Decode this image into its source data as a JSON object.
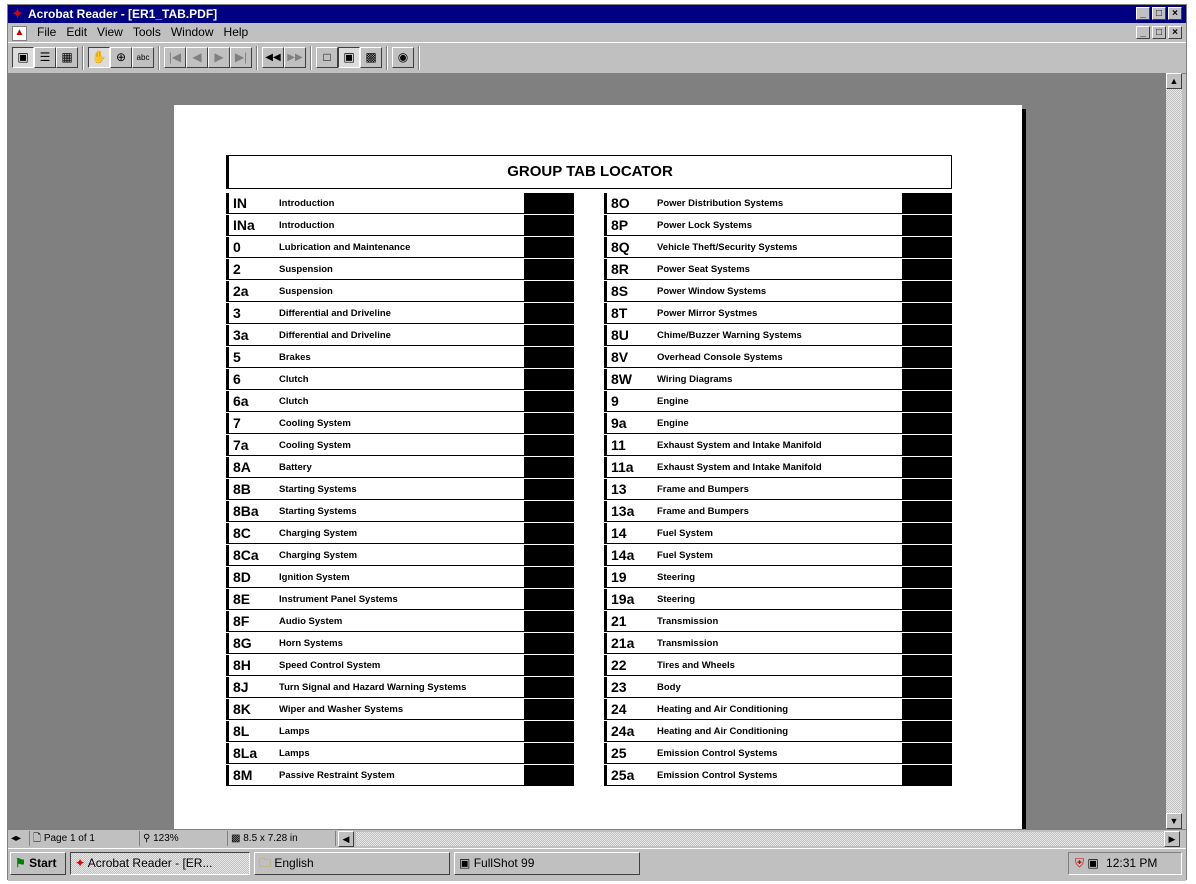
{
  "window": {
    "title": "Acrobat Reader - [ER1_TAB.PDF]",
    "app_icon": "acrobat-icon",
    "controls": [
      "_",
      "□",
      "×"
    ]
  },
  "menu": {
    "items": [
      {
        "label": "File"
      },
      {
        "label": "Edit"
      },
      {
        "label": "View"
      },
      {
        "label": "Tools"
      },
      {
        "label": "Window"
      },
      {
        "label": "Help"
      }
    ]
  },
  "toolbar": {
    "buttons": [
      "page-only-icon",
      "bookmarks-and-page-icon",
      "thumbnails-and-page-icon",
      "hand-tool-icon",
      "zoom-tool-icon",
      "text-select-icon",
      "first-page-icon",
      "previous-page-icon",
      "next-page-icon",
      "last-page-icon",
      "go-back-icon",
      "go-forward-icon",
      "actual-size-icon",
      "fit-page-icon",
      "fit-width-icon",
      "find-icon"
    ]
  },
  "document": {
    "heading": "GROUP TAB LOCATOR",
    "left_column": [
      {
        "code": "IN",
        "desc": "Introduction"
      },
      {
        "code": "INa",
        "desc": "Introduction"
      },
      {
        "code": "0",
        "desc": "Lubrication and Maintenance"
      },
      {
        "code": "2",
        "desc": "Suspension"
      },
      {
        "code": "2a",
        "desc": "Suspension"
      },
      {
        "code": "3",
        "desc": "Differential and Driveline"
      },
      {
        "code": "3a",
        "desc": "Differential and Driveline"
      },
      {
        "code": "5",
        "desc": "Brakes"
      },
      {
        "code": "6",
        "desc": "Clutch"
      },
      {
        "code": "6a",
        "desc": "Clutch"
      },
      {
        "code": "7",
        "desc": "Cooling System"
      },
      {
        "code": "7a",
        "desc": "Cooling System"
      },
      {
        "code": "8A",
        "desc": "Battery"
      },
      {
        "code": "8B",
        "desc": "Starting Systems"
      },
      {
        "code": "8Ba",
        "desc": "Starting Systems"
      },
      {
        "code": "8C",
        "desc": "Charging System"
      },
      {
        "code": "8Ca",
        "desc": "Charging System"
      },
      {
        "code": "8D",
        "desc": "Ignition System"
      },
      {
        "code": "8E",
        "desc": "Instrument Panel Systems"
      },
      {
        "code": "8F",
        "desc": "Audio System"
      },
      {
        "code": "8G",
        "desc": "Horn Systems"
      },
      {
        "code": "8H",
        "desc": "Speed Control System"
      },
      {
        "code": "8J",
        "desc": "Turn Signal and Hazard Warning Systems"
      },
      {
        "code": "8K",
        "desc": "Wiper and Washer Systems"
      },
      {
        "code": "8L",
        "desc": "Lamps"
      },
      {
        "code": "8La",
        "desc": "Lamps"
      },
      {
        "code": "8M",
        "desc": "Passive Restraint System"
      }
    ],
    "right_column": [
      {
        "code": "8O",
        "desc": "Power Distribution Systems"
      },
      {
        "code": "8P",
        "desc": "Power Lock Systems"
      },
      {
        "code": "8Q",
        "desc": "Vehicle Theft/Security Systems"
      },
      {
        "code": "8R",
        "desc": "Power Seat Systems"
      },
      {
        "code": "8S",
        "desc": "Power Window Systems"
      },
      {
        "code": "8T",
        "desc": "Power Mirror Systmes"
      },
      {
        "code": "8U",
        "desc": "Chime/Buzzer Warning Systems"
      },
      {
        "code": "8V",
        "desc": "Overhead Console Systems"
      },
      {
        "code": "8W",
        "desc": "Wiring Diagrams"
      },
      {
        "code": "9",
        "desc": "Engine"
      },
      {
        "code": "9a",
        "desc": "Engine"
      },
      {
        "code": "11",
        "desc": "Exhaust System and Intake Manifold"
      },
      {
        "code": "11a",
        "desc": "Exhaust System and Intake Manifold"
      },
      {
        "code": "13",
        "desc": "Frame and Bumpers"
      },
      {
        "code": "13a",
        "desc": "Frame and Bumpers"
      },
      {
        "code": "14",
        "desc": "Fuel System"
      },
      {
        "code": "14a",
        "desc": "Fuel System"
      },
      {
        "code": "19",
        "desc": "Steering"
      },
      {
        "code": "19a",
        "desc": "Steering"
      },
      {
        "code": "21",
        "desc": "Transmission"
      },
      {
        "code": "21a",
        "desc": "Transmission"
      },
      {
        "code": "22",
        "desc": "Tires and Wheels"
      },
      {
        "code": "23",
        "desc": "Body"
      },
      {
        "code": "24",
        "desc": "Heating and Air Conditioning"
      },
      {
        "code": "24a",
        "desc": "Heating and Air Conditioning"
      },
      {
        "code": "25",
        "desc": "Emission Control Systems"
      },
      {
        "code": "25a",
        "desc": "Emission Control Systems"
      }
    ]
  },
  "statusbar": {
    "page": "Page 1 of 1",
    "zoom": "123%",
    "page_size": "8.5 x 7.28 in"
  },
  "taskbar": {
    "start": "Start",
    "tasks": [
      {
        "label": "Acrobat Reader - [ER...",
        "icon": "acrobat-icon",
        "active": true
      },
      {
        "label": "English",
        "icon": "folder-icon",
        "active": false
      },
      {
        "label": "FullShot 99",
        "icon": "fullshot-icon",
        "active": false
      }
    ],
    "clock": "12:31 PM"
  },
  "colors": {
    "titlebar": "#000080",
    "chrome": "#c0c0c0",
    "workarea": "#808080",
    "page": "#ffffff",
    "tab_block": "#000000"
  }
}
